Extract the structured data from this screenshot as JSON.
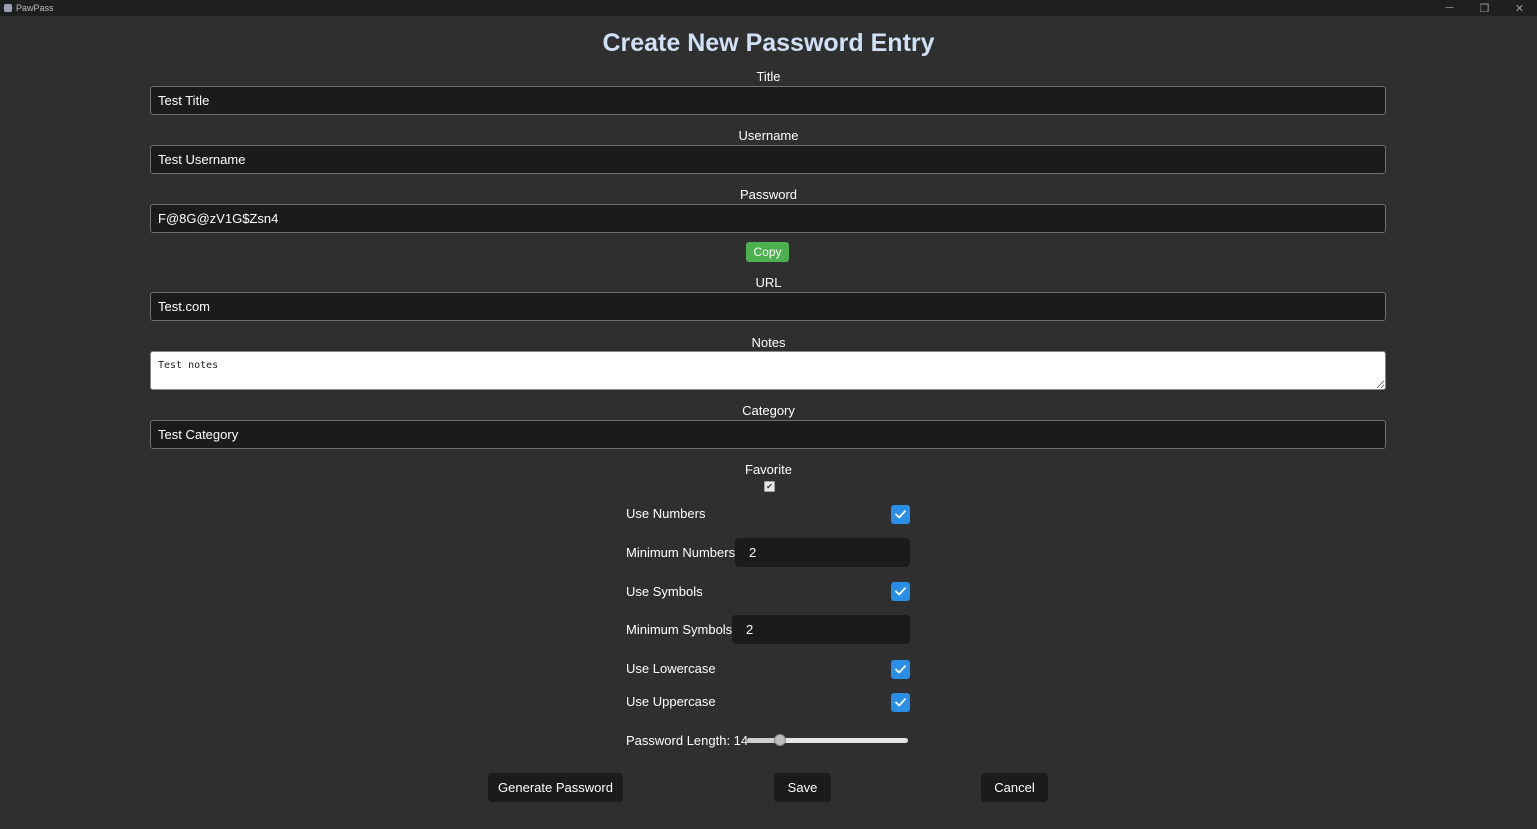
{
  "window": {
    "title": "PawPass",
    "controls": {
      "minimize": "─",
      "restore": "❐",
      "close": "✕"
    }
  },
  "heading": "Create New Password Entry",
  "form": {
    "title": {
      "label": "Title",
      "value": "Test Title"
    },
    "username": {
      "label": "Username",
      "value": "Test Username"
    },
    "password": {
      "label": "Password",
      "value": "F@8G@zV1G$Zsn4"
    },
    "copy_button": "Copy",
    "url": {
      "label": "URL",
      "value": "Test.com"
    },
    "notes": {
      "label": "Notes",
      "value": "Test notes"
    },
    "category": {
      "label": "Category",
      "value": "Test Category"
    },
    "favorite": {
      "label": "Favorite",
      "checked": true
    }
  },
  "generator": {
    "use_numbers": {
      "label": "Use Numbers",
      "checked": true
    },
    "min_numbers": {
      "label": "Minimum Numbers",
      "value": "2"
    },
    "use_symbols": {
      "label": "Use Symbols",
      "checked": true
    },
    "min_symbols": {
      "label": "Minimum Symbols",
      "value": "2"
    },
    "use_lowercase": {
      "label": "Use Lowercase",
      "checked": true
    },
    "use_uppercase": {
      "label": "Use Uppercase",
      "checked": true
    },
    "length": {
      "label": "Password Length: 14",
      "value": 14,
      "fraction": 0.18
    }
  },
  "actions": {
    "generate": "Generate Password",
    "save": "Save",
    "cancel": "Cancel"
  },
  "colors": {
    "background": "#2f2f2f",
    "heading": "#cfe0f7",
    "copy_button": "#4caf50",
    "checkbox": "#2b8ee6"
  }
}
